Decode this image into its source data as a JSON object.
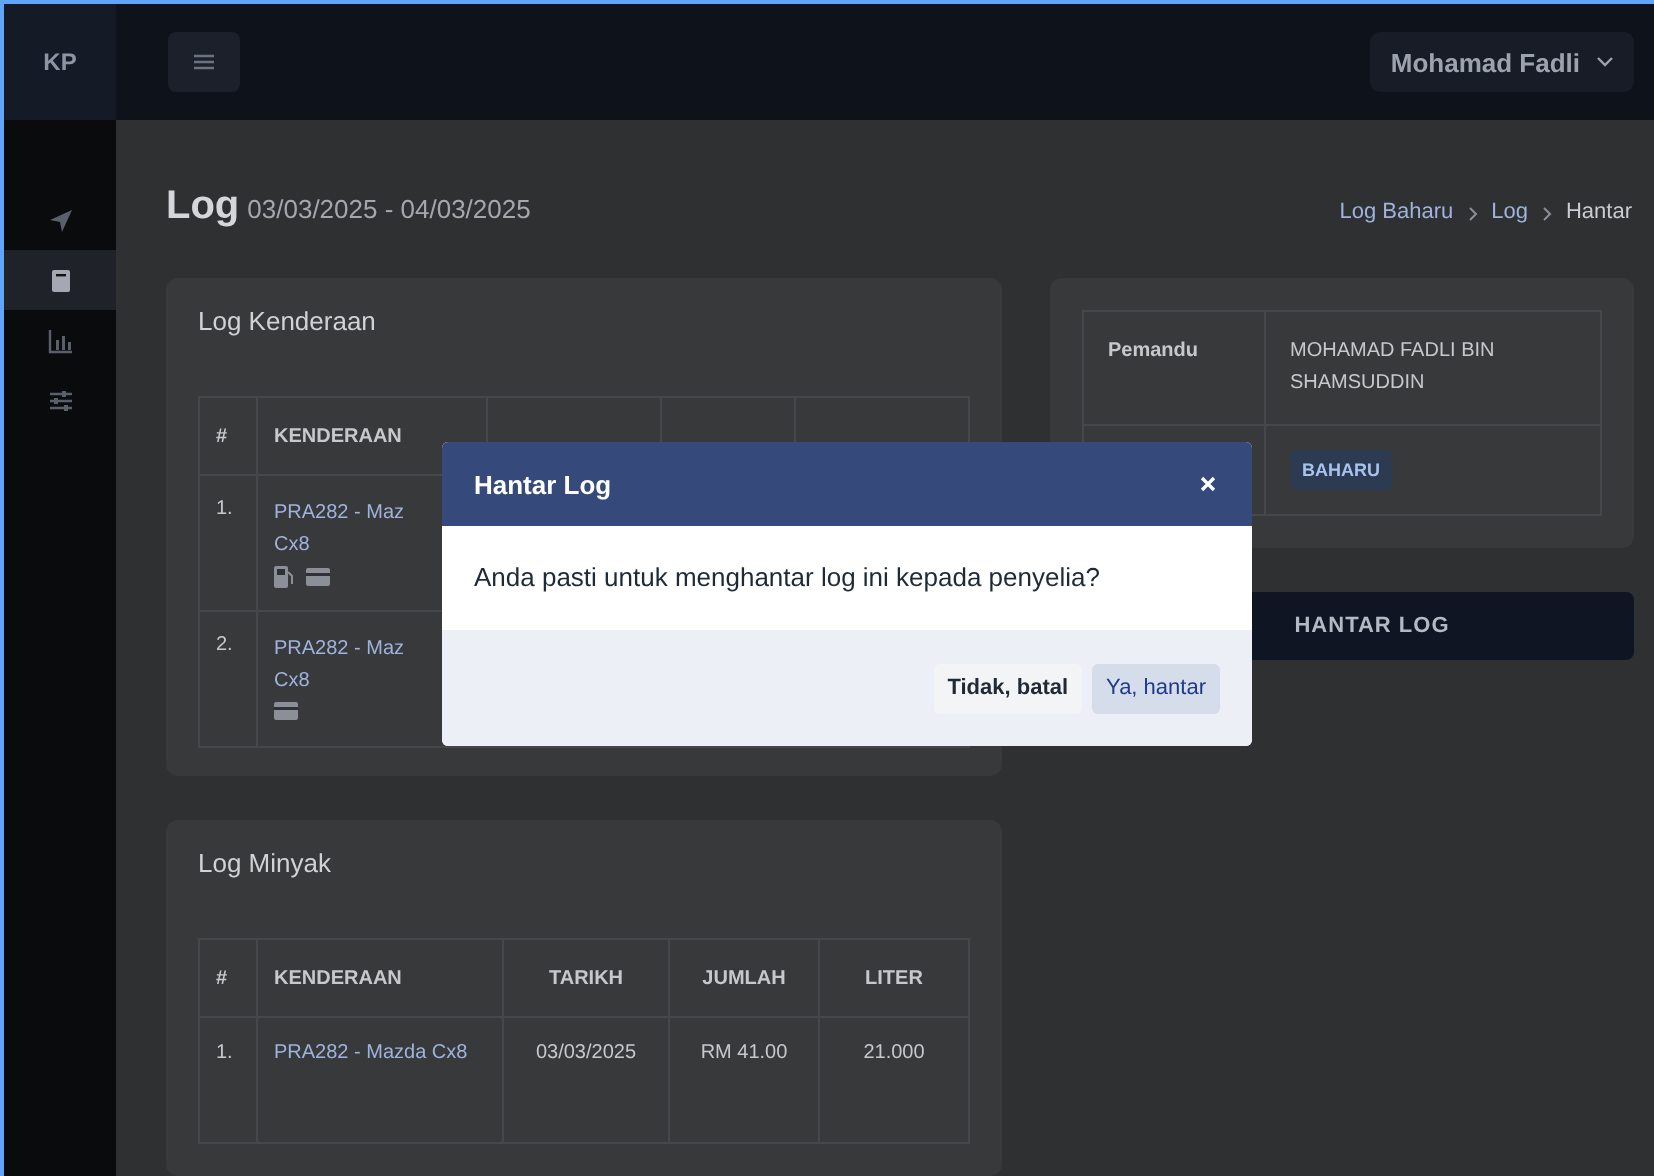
{
  "topbar": {
    "logo": "KP",
    "user": "Mohamad Fadli"
  },
  "sidebar": {
    "items": [
      {
        "selected": false
      },
      {
        "selected": true
      },
      {
        "selected": false
      },
      {
        "selected": false
      }
    ]
  },
  "page": {
    "title": "Log",
    "date_range": "03/03/2025 - 04/03/2025",
    "breadcrumb": [
      "Log Baharu",
      "Log",
      "Hantar"
    ]
  },
  "vehicle_log": {
    "title": "Log Kenderaan",
    "columns": [
      "#",
      "KENDERAAN"
    ],
    "rows": [
      {
        "number": "1.",
        "vehicle": [
          "PRA282 - Maz",
          "Cx8"
        ],
        "has_fuel": true,
        "has_card": true
      },
      {
        "number": "2.",
        "vehicle": [
          "PRA282 - Maz",
          "Cx8"
        ],
        "has_fuel": false,
        "has_card": true
      }
    ]
  },
  "fuel_log": {
    "title": "Log Minyak",
    "columns": [
      "#",
      "KENDERAAN",
      "TARIKH",
      "JUMLAH",
      "LITER"
    ],
    "rows": [
      {
        "cells": [
          "1.",
          "PRA282 - Mazda Cx8",
          "03/03/2025",
          "RM 41.00",
          "21.000"
        ]
      }
    ]
  },
  "summary": {
    "rows": [
      {
        "kind": "text",
        "label": "Pemandu",
        "value": "MOHAMAD FADLI BIN SHAMSUDDIN"
      },
      {
        "kind": "badge",
        "value": "BAHARU"
      }
    ]
  },
  "submit_button": "HANTAR LOG",
  "dialog": {
    "title": "Hantar Log",
    "message": "Anda pasti untuk menghantar log ini kepada penyelia?",
    "buttons": [
      {
        "kind": "secondary",
        "label": "Tidak, batal"
      },
      {
        "kind": "primary",
        "label": "Ya, hantar"
      }
    ]
  }
}
